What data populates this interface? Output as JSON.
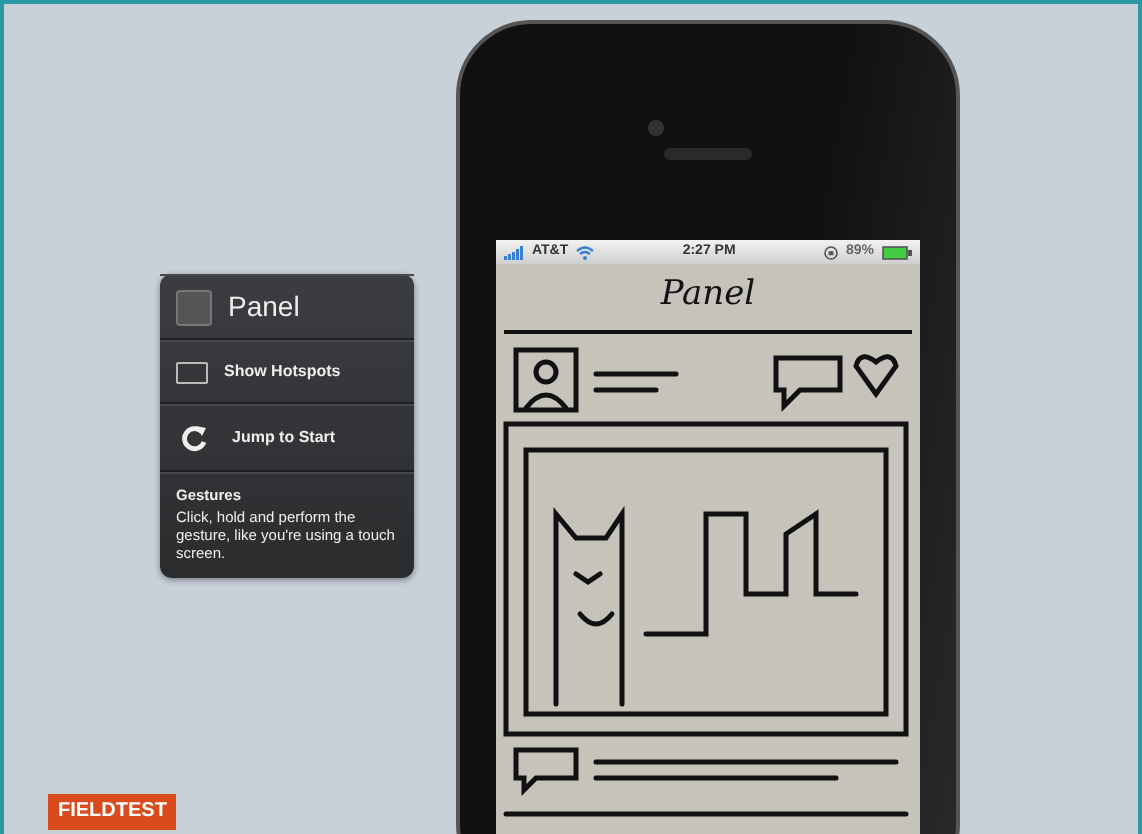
{
  "panel": {
    "title": "Panel",
    "items": [
      {
        "kind": "checkbox",
        "label": "Show Hotspots",
        "checked": false
      },
      {
        "kind": "action",
        "label": "Jump to Start"
      }
    ],
    "gestures": {
      "title": "Gestures",
      "text": "Click, hold and perform the gesture, like you're using a touch screen."
    }
  },
  "phone": {
    "status_bar": {
      "carrier": "AT&T",
      "time": "2:27 PM",
      "battery": "89%"
    },
    "sketch_title": "Panel"
  },
  "logo": "FIELDTEST"
}
